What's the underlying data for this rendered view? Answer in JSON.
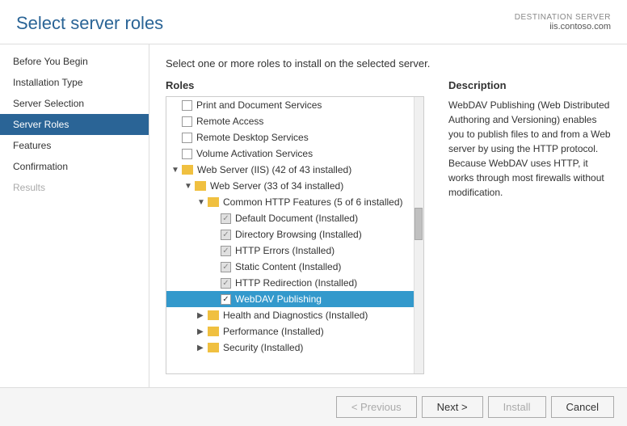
{
  "header": {
    "title": "Select server roles",
    "dest_server_label": "DESTINATION SERVER",
    "dest_server_name": "iis.contoso.com"
  },
  "sidebar": {
    "items": [
      {
        "label": "Before You Begin",
        "state": "normal"
      },
      {
        "label": "Installation Type",
        "state": "normal"
      },
      {
        "label": "Server Selection",
        "state": "normal"
      },
      {
        "label": "Server Roles",
        "state": "active"
      },
      {
        "label": "Features",
        "state": "normal"
      },
      {
        "label": "Confirmation",
        "state": "normal"
      },
      {
        "label": "Results",
        "state": "disabled"
      }
    ]
  },
  "content": {
    "instruction": "Select one or more roles to install on the selected server.",
    "roles_label": "Roles",
    "roles": [
      {
        "id": "print",
        "label": "Print and Document Services",
        "indent": 0,
        "cb": "unchecked",
        "expand": false,
        "folder": false
      },
      {
        "id": "remote-access",
        "label": "Remote Access",
        "indent": 0,
        "cb": "unchecked",
        "expand": false,
        "folder": false
      },
      {
        "id": "remote-desktop",
        "label": "Remote Desktop Services",
        "indent": 0,
        "cb": "unchecked",
        "expand": false,
        "folder": false
      },
      {
        "id": "volume-activation",
        "label": "Volume Activation Services",
        "indent": 0,
        "cb": "unchecked",
        "expand": false,
        "folder": false
      },
      {
        "id": "web-server-iis",
        "label": "Web Server (IIS) (42 of 43 installed)",
        "indent": 0,
        "cb": "none",
        "expand": "down",
        "folder": true
      },
      {
        "id": "web-server",
        "label": "Web Server (33 of 34 installed)",
        "indent": 1,
        "cb": "none",
        "expand": "down",
        "folder": true
      },
      {
        "id": "common-http",
        "label": "Common HTTP Features (5 of 6 installed)",
        "indent": 2,
        "cb": "none",
        "expand": "down",
        "folder": true
      },
      {
        "id": "default-doc",
        "label": "Default Document (Installed)",
        "indent": 3,
        "cb": "grayed",
        "expand": false,
        "folder": false
      },
      {
        "id": "dir-browsing",
        "label": "Directory Browsing (Installed)",
        "indent": 3,
        "cb": "grayed",
        "expand": false,
        "folder": false
      },
      {
        "id": "http-errors",
        "label": "HTTP Errors (Installed)",
        "indent": 3,
        "cb": "grayed",
        "expand": false,
        "folder": false
      },
      {
        "id": "static-content",
        "label": "Static Content (Installed)",
        "indent": 3,
        "cb": "grayed",
        "expand": false,
        "folder": false
      },
      {
        "id": "http-redirection",
        "label": "HTTP Redirection (Installed)",
        "indent": 3,
        "cb": "grayed",
        "expand": false,
        "folder": false
      },
      {
        "id": "webdav",
        "label": "WebDAV Publishing",
        "indent": 3,
        "cb": "checked",
        "expand": false,
        "folder": false,
        "selected": true
      },
      {
        "id": "health-diag",
        "label": "Health and Diagnostics (Installed)",
        "indent": 2,
        "cb": "none",
        "expand": "right",
        "folder": true
      },
      {
        "id": "performance",
        "label": "Performance (Installed)",
        "indent": 2,
        "cb": "none",
        "expand": "right",
        "folder": true
      },
      {
        "id": "security",
        "label": "Security (Installed)",
        "indent": 2,
        "cb": "grayed",
        "expand": "right",
        "folder": true
      }
    ],
    "description_label": "Description",
    "description": "WebDAV Publishing (Web Distributed Authoring and Versioning) enables you to publish files to and from a Web server by using the HTTP protocol. Because WebDAV uses HTTP, it works through most firewalls without modification."
  },
  "footer": {
    "previous_label": "< Previous",
    "next_label": "Next >",
    "install_label": "Install",
    "cancel_label": "Cancel"
  }
}
